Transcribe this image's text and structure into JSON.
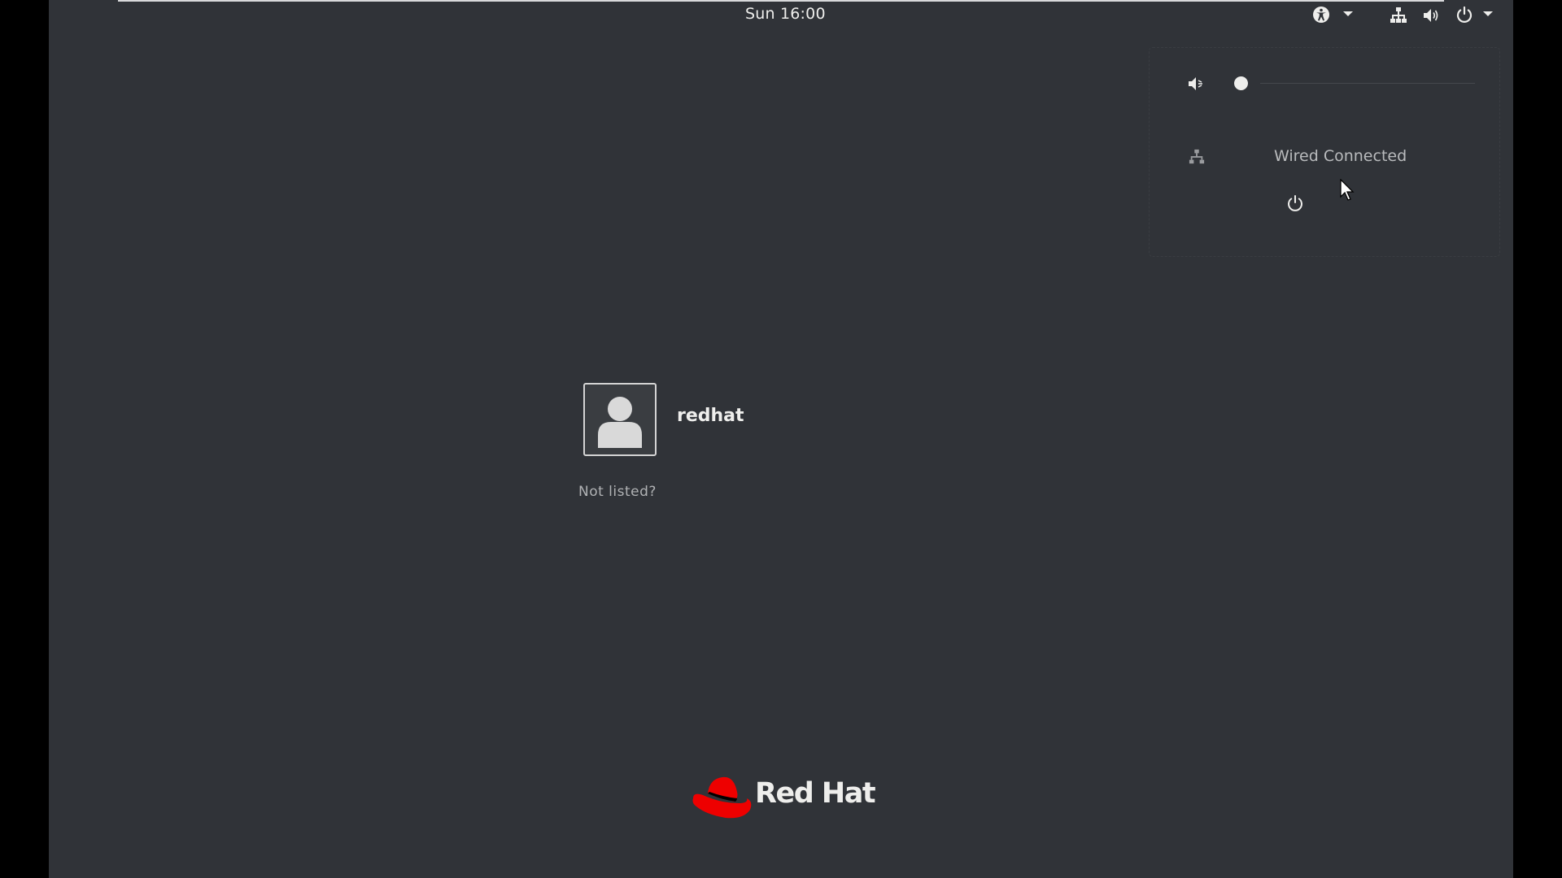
{
  "topbar": {
    "clock": "Sun 16:00",
    "icons": [
      "accessibility-icon",
      "chevron-down-icon",
      "network-wired-icon",
      "volume-icon",
      "power-icon",
      "chevron-down-icon"
    ]
  },
  "system_menu": {
    "volume_icon": "volume-muted-icon",
    "volume_level": 0,
    "wired_icon": "network-wired-icon",
    "wired_label": "Wired Connected",
    "power_icon": "power-icon"
  },
  "login": {
    "user_name": "redhat",
    "avatar_icon": "user-avatar-icon",
    "not_listed": "Not listed?"
  },
  "branding": {
    "logo_text": "Red Hat",
    "logo_color": "#ee0000"
  },
  "colors": {
    "background": "#303338",
    "text": "#eeeeec",
    "muted_text": "#b0b2b4"
  }
}
